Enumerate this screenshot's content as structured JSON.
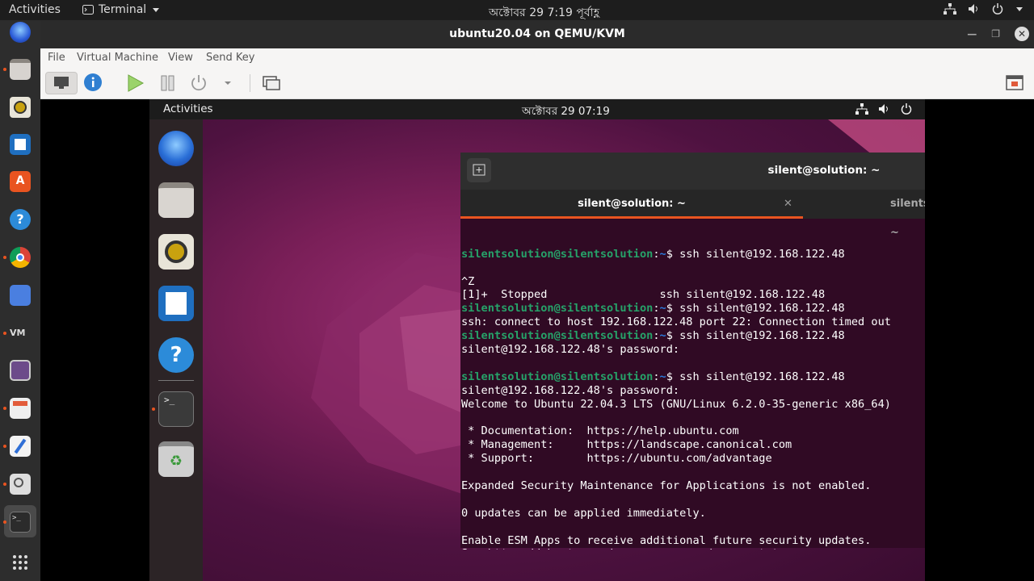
{
  "host_topbar": {
    "activities": "Activities",
    "app_menu": "Terminal",
    "clock": "অক্টোবর 29  7:19 পূর্বাহ্ণ"
  },
  "vm_window": {
    "title": "ubuntu20.04 on QEMU/KVM",
    "menu": [
      "File",
      "Virtual Machine",
      "View",
      "Send Key"
    ]
  },
  "guest": {
    "activities": "Activities",
    "clock": "অক্টোবর 29  07:19",
    "terminal": {
      "title": "silent@solution: ~",
      "tabs": [
        "silent@solution: ~",
        "silentsolution@silentsolution: ~"
      ],
      "lines": [
        {
          "user": "silentsolution@silentsolution",
          "path": "~",
          "cmd": "$ ssh silent@192.168.122.48"
        },
        {
          "text": ""
        },
        {
          "text": "^Z"
        },
        {
          "text": "[1]+  Stopped                 ssh silent@192.168.122.48"
        },
        {
          "user": "silentsolution@silentsolution",
          "path": "~",
          "cmd": "$ ssh silent@192.168.122.48"
        },
        {
          "text": "ssh: connect to host 192.168.122.48 port 22: Connection timed out"
        },
        {
          "user": "silentsolution@silentsolution",
          "path": "~",
          "cmd": "$ ssh silent@192.168.122.48"
        },
        {
          "text": "silent@192.168.122.48's password:"
        },
        {
          "text": ""
        },
        {
          "user": "silentsolution@silentsolution",
          "path": "~",
          "cmd": "$ ssh silent@192.168.122.48"
        },
        {
          "text": "silent@192.168.122.48's password:"
        },
        {
          "text": "Welcome to Ubuntu 22.04.3 LTS (GNU/Linux 6.2.0-35-generic x86_64)"
        },
        {
          "text": ""
        },
        {
          "text": " * Documentation:  https://help.ubuntu.com"
        },
        {
          "text": " * Management:     https://landscape.canonical.com"
        },
        {
          "text": " * Support:        https://ubuntu.com/advantage"
        },
        {
          "text": ""
        },
        {
          "text": "Expanded Security Maintenance for Applications is not enabled."
        },
        {
          "text": ""
        },
        {
          "text": "0 updates can be applied immediately."
        },
        {
          "text": ""
        },
        {
          "text": "Enable ESM Apps to receive additional future security updates."
        },
        {
          "text": "See https://ubuntu.com/esm or run: sudo pro status"
        }
      ]
    }
  },
  "colors": {
    "ubuntu_orange": "#e95420",
    "terminal_bg": "#300a24",
    "prompt_user": "#26a269",
    "prompt_path": "#2a7bde"
  }
}
